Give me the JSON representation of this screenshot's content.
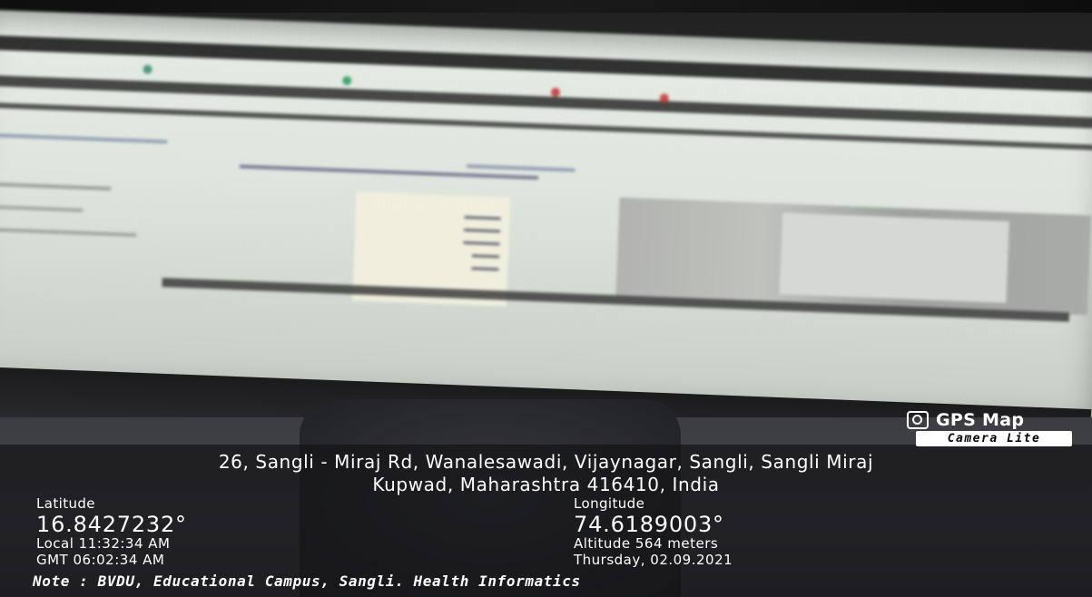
{
  "branding": {
    "icon": "camera-icon",
    "title": "GPS Map",
    "subtitle": "Camera Lite"
  },
  "address": {
    "line1": "26, Sangli - Miraj Rd, Wanalesawadi, Vijaynagar, Sangli, Sangli Miraj",
    "line2": "Kupwad, Maharashtra 416410, India"
  },
  "coordinates": {
    "latitude_label": "Latitude",
    "latitude_value": "16.8427232°",
    "longitude_label": "Longitude",
    "longitude_value": "74.6189003°"
  },
  "time": {
    "local": "Local 11:32:34 AM",
    "gmt": "GMT 06:02:34 AM"
  },
  "meta": {
    "altitude": "Altitude 564 meters",
    "date": "Thursday, 02.09.2021"
  },
  "note": "Note : BVDU, Educational Campus, Sangli. Health Informatics",
  "colors": {
    "overlay": "#141416",
    "text": "#ffffff",
    "badge_bg": "#ffffff",
    "badge_text": "#000000"
  }
}
